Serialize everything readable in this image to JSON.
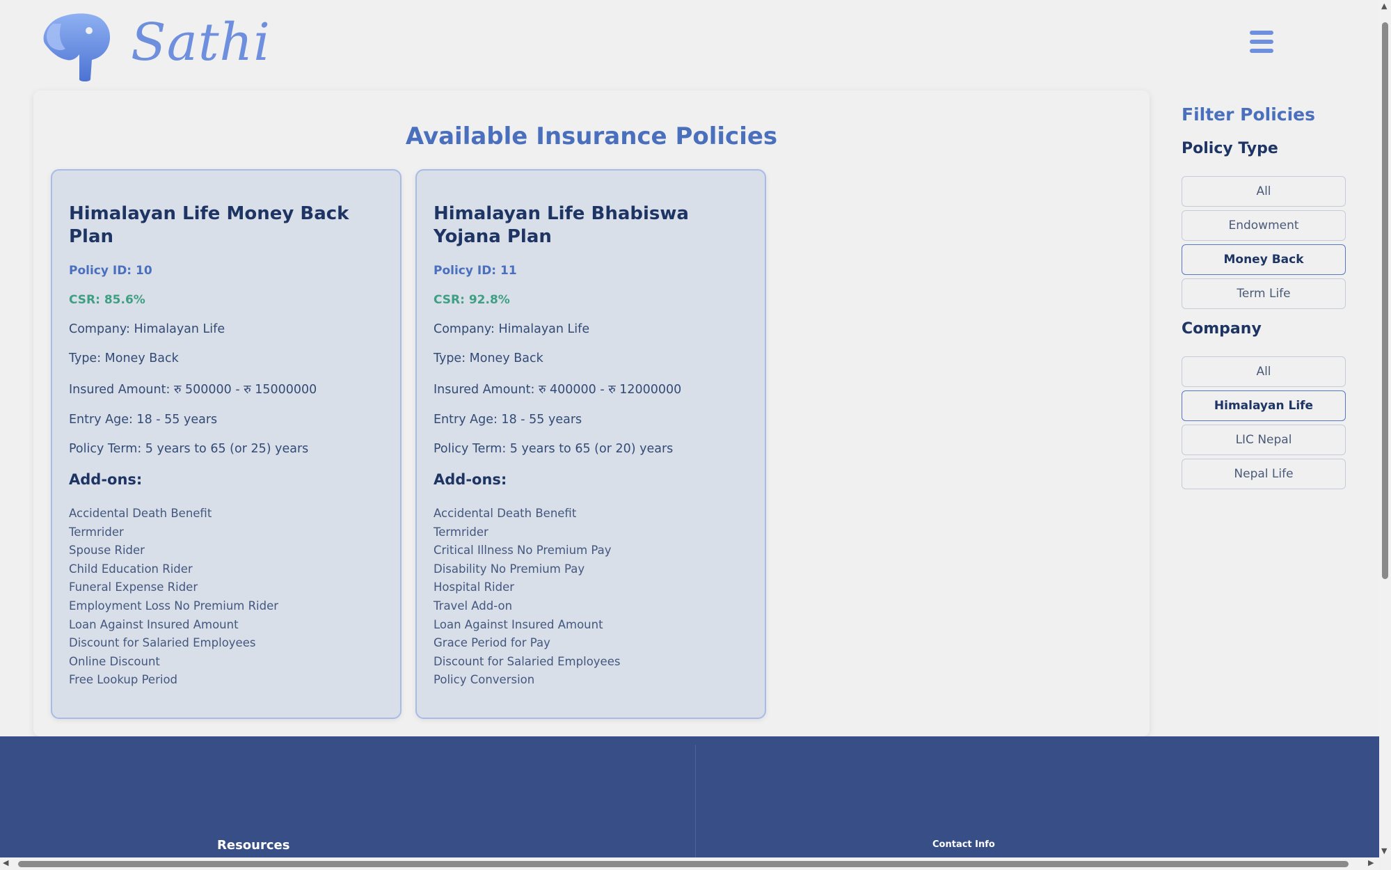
{
  "logo": {
    "text": "Sathi"
  },
  "header": {
    "menu_icon": "hamburger-icon"
  },
  "main": {
    "title": "Available Insurance Policies"
  },
  "policies": [
    {
      "name": "Himalayan Life Money Back Plan",
      "policy_id": "Policy ID: 10",
      "csr": "CSR: 85.6%",
      "company": "Company: Himalayan Life",
      "type": "Type: Money Back",
      "insured_amount": "Insured Amount: रु 500000 - रु 15000000",
      "entry_age": "Entry Age: 18 - 55 years",
      "policy_term": "Policy Term: 5 years to 65 (or 25) years",
      "addons_heading": "Add-ons:",
      "addons": [
        "Accidental Death Benefit",
        "Termrider",
        "Spouse Rider",
        "Child Education Rider",
        "Funeral Expense Rider",
        "Employment Loss No Premium Rider",
        "Loan Against Insured Amount",
        "Discount for Salaried Employees",
        "Online Discount",
        "Free Lookup Period"
      ]
    },
    {
      "name": "Himalayan Life Bhabiswa Yojana Plan",
      "policy_id": "Policy ID: 11",
      "csr": "CSR: 92.8%",
      "company": "Company: Himalayan Life",
      "type": "Type: Money Back",
      "insured_amount": "Insured Amount: रु 400000 - रु 12000000",
      "entry_age": "Entry Age: 18 - 55 years",
      "policy_term": "Policy Term: 5 years to 65 (or 20) years",
      "addons_heading": "Add-ons:",
      "addons": [
        "Accidental Death Benefit",
        "Termrider",
        "Critical Illness No Premium Pay",
        "Disability No Premium Pay",
        "Hospital Rider",
        "Travel Add-on",
        "Loan Against Insured Amount",
        "Grace Period for Pay",
        "Discount for Salaried Employees",
        "Policy Conversion"
      ]
    }
  ],
  "filters": {
    "title": "Filter Policies",
    "policy_type": {
      "heading": "Policy Type",
      "options": [
        "All",
        "Endowment",
        "Money Back",
        "Term Life"
      ],
      "selected": "Money Back"
    },
    "company": {
      "heading": "Company",
      "options": [
        "All",
        "Himalayan Life",
        "LIC Nepal",
        "Nepal Life"
      ],
      "selected": "Himalayan Life"
    }
  },
  "footer": {
    "resources": "Resources",
    "contact": "Contact Info"
  }
}
